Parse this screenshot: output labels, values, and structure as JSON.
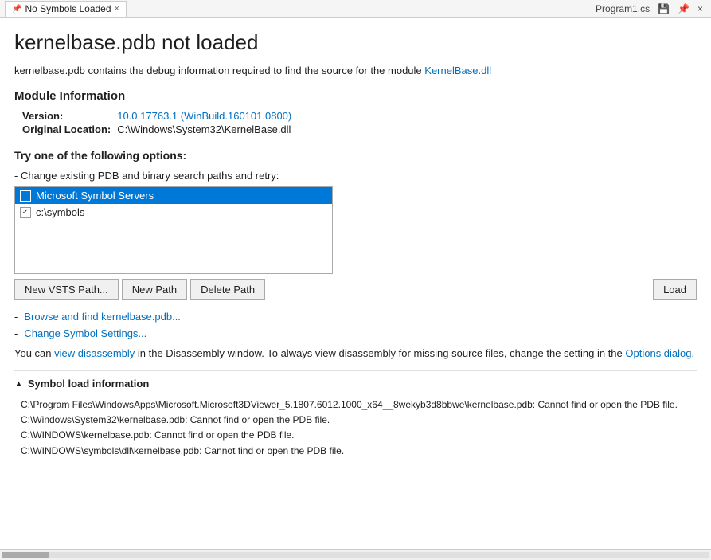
{
  "titleBar": {
    "tab": {
      "label": "No Symbols Loaded",
      "pinIcon": "📌",
      "closeIcon": "×"
    },
    "rightTitle": "Program1.cs",
    "icons": {
      "save": "💾",
      "close": "×"
    }
  },
  "page": {
    "title": "kernelbase.pdb not loaded",
    "description_prefix": "kernelbase.pdb contains the debug information required to find the source for the module ",
    "description_highlight": "KernelBase.dll",
    "moduleInfo": {
      "sectionTitle": "Module Information",
      "versionLabel": "Version:",
      "versionValue": "10.0.17763.1 (WinBuild.160101.0800)",
      "locationLabel": "Original Location:",
      "locationValue": "C:\\Windows\\System32\\KernelBase.dll"
    },
    "options": {
      "sectionTitle": "Try one of the following options:",
      "changePaths": {
        "label": "- Change existing PDB and binary search paths and retry:",
        "items": [
          {
            "text": "Microsoft Symbol Servers",
            "checked": false,
            "selected": true
          },
          {
            "text": "c:\\symbols",
            "checked": true,
            "selected": false
          }
        ]
      },
      "buttons": {
        "newVsts": "New VSTS Path...",
        "newPath": "New Path",
        "deletePath": "Delete Path",
        "load": "Load"
      }
    },
    "links": {
      "browse": "Browse and find kernelbase.pdb...",
      "changeSymbol": "Change Symbol Settings..."
    },
    "infoText": {
      "prefix": "You can ",
      "viewDisassembly": "view disassembly",
      "middle": " in the Disassembly window. To always view disassembly for missing source files, change the setting in the ",
      "optionsDialog": "Options dialog",
      "suffix": "."
    },
    "symbolLoad": {
      "sectionTitle": "Symbol load information",
      "logs": [
        "C:\\Program Files\\WindowsApps\\Microsoft.Microsoft3DViewer_5.1807.6012.1000_x64__8wekyb3d8bbwe\\kernelbase.pdb: Cannot find or open the PDB file.",
        "C:\\Windows\\System32\\kernelbase.pdb: Cannot find or open the PDB file.",
        "C:\\WINDOWS\\kernelbase.pdb: Cannot find or open the PDB file.",
        "C:\\WINDOWS\\symbols\\dll\\kernelbase.pdb: Cannot find or open the PDB file."
      ]
    }
  }
}
